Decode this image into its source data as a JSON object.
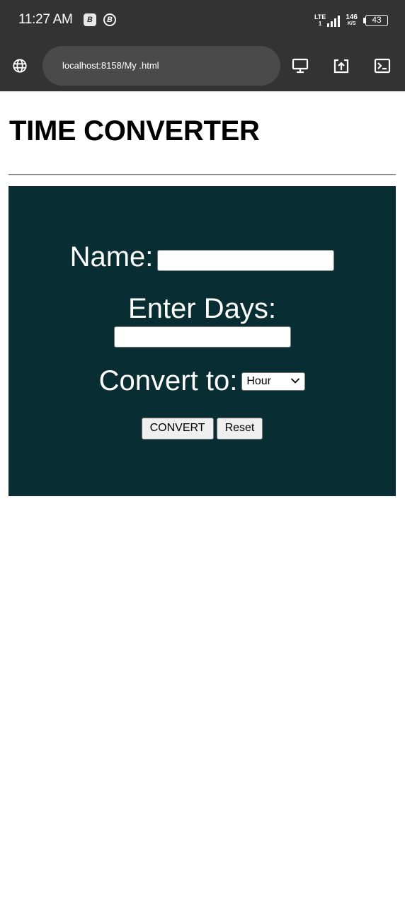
{
  "status_bar": {
    "time": "11:27 AM",
    "notif_1": "B",
    "notif_2": "B",
    "network_type": "LTE",
    "network_sub": "1",
    "speed_value": "146",
    "speed_unit": "K/S",
    "battery_level": "43"
  },
  "browser": {
    "url": "localhost:8158/My .html",
    "icons": [
      "globe-icon",
      "desktop-icon",
      "share-icon",
      "console-icon"
    ]
  },
  "page": {
    "title": "TIME CONVERTER"
  },
  "form": {
    "name_label": "Name:",
    "name_value": "",
    "days_label": "Enter Days:",
    "days_value": "",
    "convert_label": "Convert to:",
    "convert_selected": "Hour",
    "convert_button": "CONVERT",
    "reset_button": "Reset"
  },
  "colors": {
    "status_bar_bg": "#333333",
    "url_pill_bg": "#4a4a4a",
    "panel_bg": "#082d32",
    "page_bg": "#ffffff",
    "button_bg": "#efefef"
  }
}
